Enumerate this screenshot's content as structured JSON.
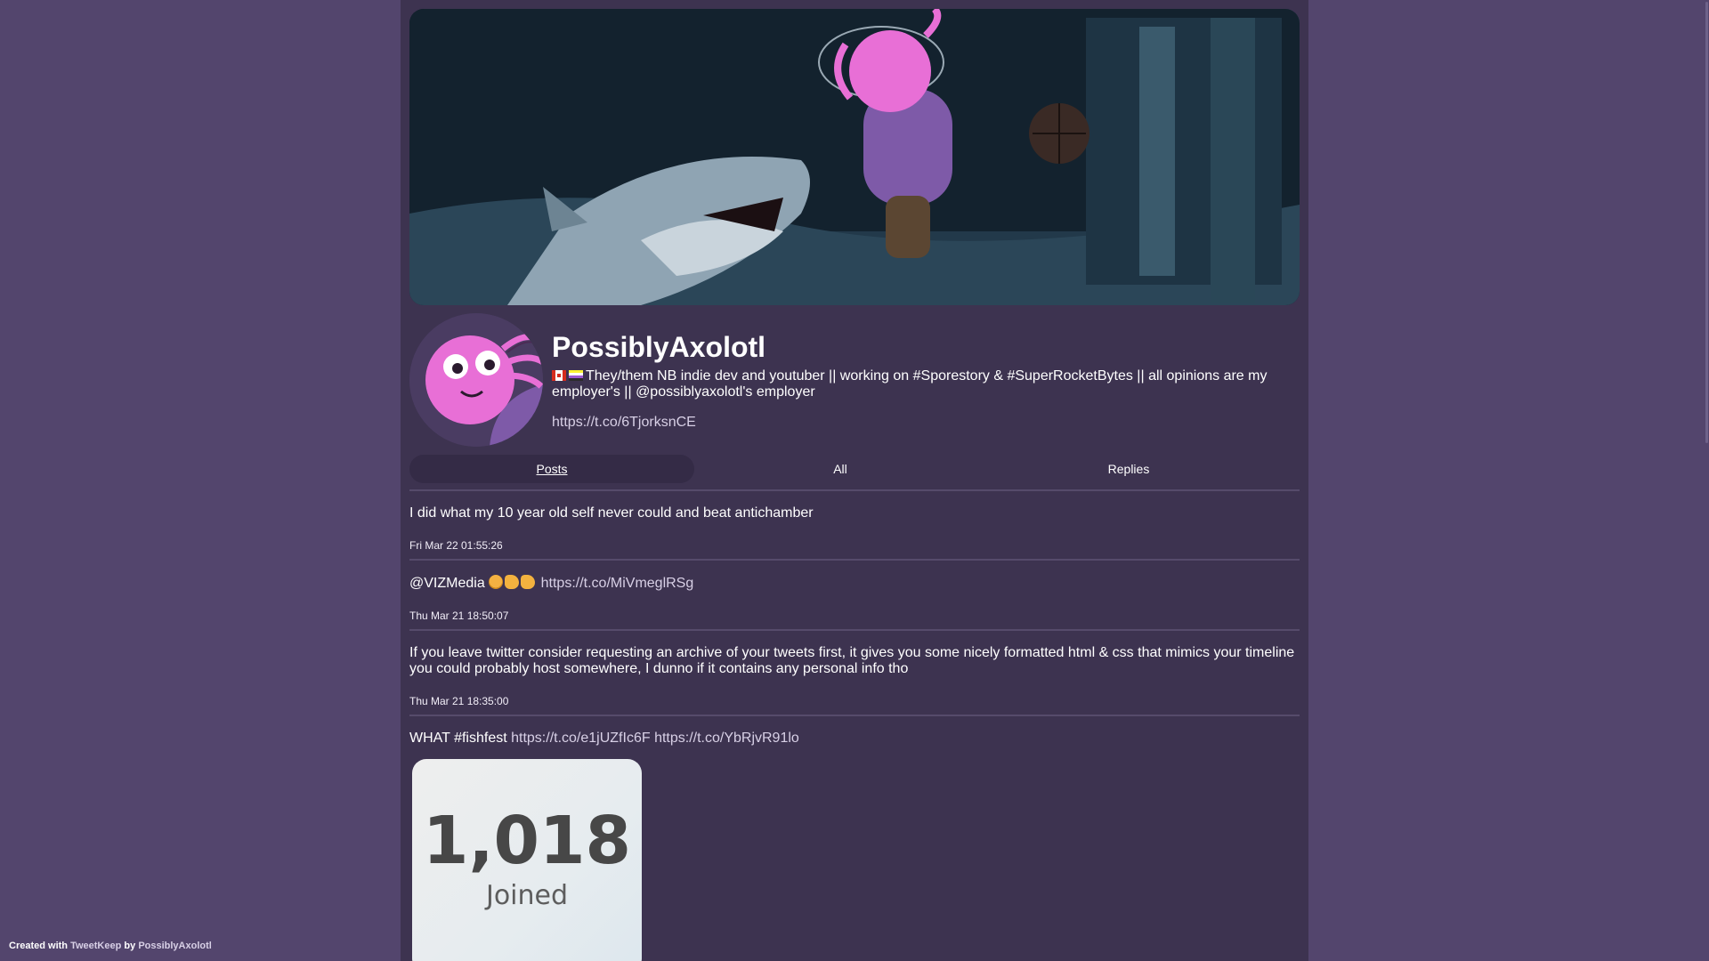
{
  "profile": {
    "name": "PossiblyAxolotl",
    "bio": "They/them NB indie dev and youtuber || working on #Sporestory & #SuperRocketBytes || all opinions are my employer's || @possiblyaxolotl's employer",
    "link": "https://t.co/6TjorksnCE"
  },
  "tabs": [
    {
      "label": "Posts",
      "active": true
    },
    {
      "label": "All",
      "active": false
    },
    {
      "label": "Replies",
      "active": false
    }
  ],
  "tweets": [
    {
      "text": "I did what my 10 year old self never could and beat antichamber",
      "time": "Fri Mar 22 01:55:26"
    },
    {
      "text": "@VIZMedia",
      "link": "https://t.co/MiVmeglRSg",
      "time": "Thu Mar 21 18:50:07"
    },
    {
      "text": "If you leave twitter consider requesting an archive of your tweets first, it gives you some nicely formatted html & css that mimics your timeline you could probably host somewhere, I dunno if it contains any personal info tho",
      "time": "Thu Mar 21 18:35:00"
    },
    {
      "text": "WHAT #fishfest",
      "link1": "https://t.co/e1jUZfIc6F",
      "link2": "https://t.co/YbRjvR91lo",
      "media": {
        "number": "1,018",
        "caption": "Joined"
      }
    }
  ],
  "footer": {
    "prefix": "Created with",
    "app": "TweetKeep",
    "by": "by",
    "author": "PossiblyAxolotl"
  },
  "colors": {
    "background": "#53456d",
    "panel": "#3d3350",
    "link": "#d8d0e6",
    "axolotl_pink": "#e86fd6",
    "hoodie_purple": "#7e5aa8"
  },
  "icons": {
    "flag_1": "canada-flag-icon",
    "flag_2": "nonbinary-flag-icon",
    "emoji_1": "flushed-face-icon",
    "emoji_2": "pointing-right-icon",
    "emoji_3": "pointing-left-icon"
  }
}
